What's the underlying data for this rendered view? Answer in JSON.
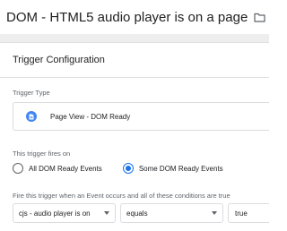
{
  "header": {
    "title": "DOM - HTML5 audio player is on a page",
    "folder_icon": "folder-icon"
  },
  "card": {
    "title": "Trigger Configuration"
  },
  "trigger_type": {
    "label": "Trigger Type",
    "value": "Page View - DOM Ready",
    "icon": "page-view-icon",
    "icon_color": "#4285f4"
  },
  "fires_on": {
    "label": "This trigger fires on",
    "options": [
      {
        "label": "All DOM Ready Events",
        "selected": false
      },
      {
        "label": "Some DOM Ready Events",
        "selected": true
      }
    ],
    "accent": "#1a73e8"
  },
  "conditions": {
    "label": "Fire this trigger when an Event occurs and all of these conditions are true",
    "variable": "cjs - audio player is on",
    "operator": "equals",
    "value": "true"
  }
}
